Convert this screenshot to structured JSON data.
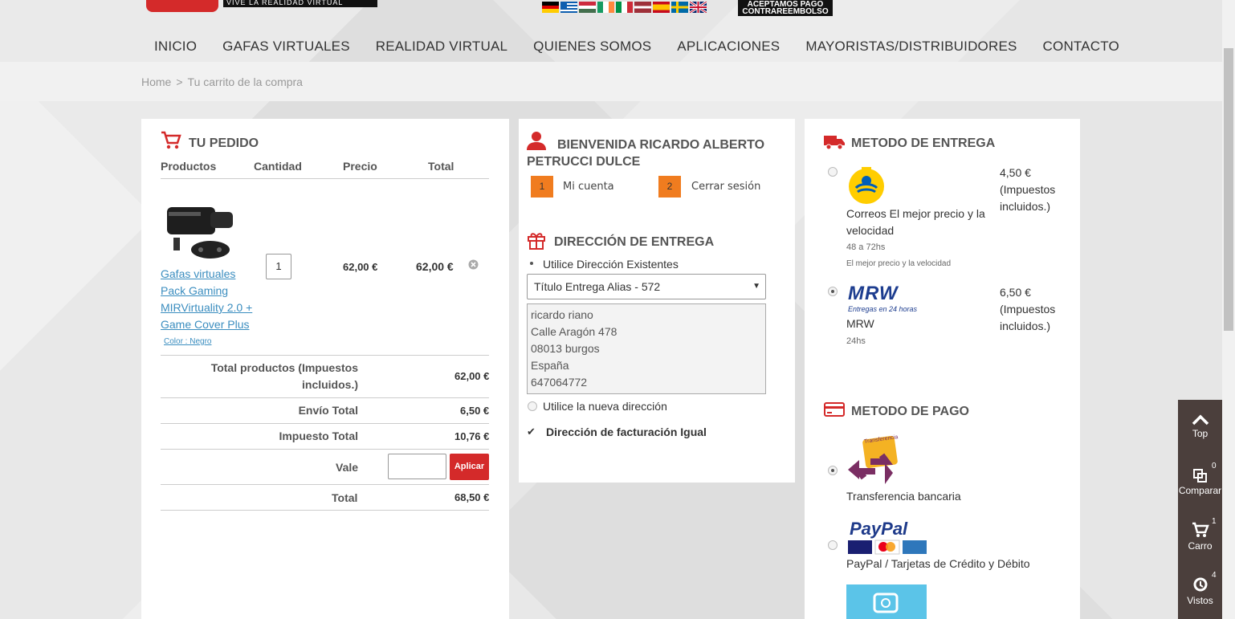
{
  "header": {
    "logo_tagline": "VIVE LA REALIDAD VIRTUAL",
    "cod_line1": "ACEPTAMOS PAGO",
    "cod_line2": "CONTRAREEMBOLSO",
    "flags": [
      "de",
      "gr",
      "hu",
      "ie",
      "it",
      "lv",
      "es",
      "se",
      "gb"
    ]
  },
  "nav": {
    "items": [
      "INICIO",
      "GAFAS VIRTUALES",
      "REALIDAD VIRTUAL",
      "QUIENES SOMOS",
      "APLICACIONES",
      "MAYORISTAS/DISTRIBUIDORES",
      "CONTACTO"
    ]
  },
  "breadcrumb": {
    "home": "Home",
    "sep": ">",
    "current": "Tu carrito de la compra"
  },
  "order": {
    "title": "TU PEDIDO",
    "col_products": "Productos",
    "col_qty": "Cantidad",
    "col_price": "Precio",
    "col_total": "Total",
    "product_name": "Gafas virtuales Pack Gaming MIRVirtuality 2.0 + Game Cover Plus",
    "product_color": "Color : Negro",
    "qty": "1",
    "price": "62,00 €",
    "total": "62,00 €",
    "subtotal_label": "Total productos (Impuestos incluidos.)",
    "subtotal_value": "62,00 €",
    "shipping_label": "Envío Total",
    "shipping_value": "6,50 €",
    "tax_label": "Impuesto Total",
    "tax_value": "10,76 €",
    "voucher_label": "Vale",
    "voucher_button": "Aplicar",
    "grand_label": "Total",
    "grand_value": "68,50 €"
  },
  "account": {
    "welcome": "BIENVENIDA RICARDO ALBERTO PETRUCCI DULCE",
    "step1_num": "1",
    "step1_label": "Mi cuenta",
    "step2_num": "2",
    "step2_label": "Cerrar sesión",
    "address_title": "DIRECCIÓN DE ENTREGA",
    "use_existing": "Utilice Dirección Existentes",
    "selected_address": "Título Entrega Alias - 572",
    "address_lines": [
      "ricardo riano",
      "Calle Aragón 478",
      "08013 burgos",
      "España",
      "647064772"
    ],
    "use_new": "Utilice la nueva dirección",
    "billing_same": "Dirección de facturación Igual"
  },
  "delivery": {
    "title": "METODO DE ENTREGA",
    "options": [
      {
        "name": "Correos El mejor precio y la velocidad",
        "time": "48 a 72hs",
        "desc": "El mejor precio y la velocidad",
        "price": "4,50 €",
        "tax": "(Impuestos incluidos.)",
        "logo": "correos-logo"
      },
      {
        "name": "MRW",
        "time": "24hs",
        "price": "6,50 €",
        "tax": "(Impuestos incluidos.)",
        "logo": "mrw-logo",
        "logo_text": "MRW",
        "logo_sub": "Entregas en 24 horas"
      }
    ]
  },
  "payment": {
    "title": "METODO DE PAGO",
    "options": [
      {
        "name": "Transferencia bancaria",
        "logo_text": "Transferencia"
      },
      {
        "name": "PayPal / Tarjetas de Crédito y Débito",
        "logo_text": "PayPal"
      }
    ]
  },
  "sidebar": {
    "top": "Top",
    "compare": "Comparar",
    "compare_count": "0",
    "cart": "Carro",
    "cart_count": "1",
    "viewed": "Vistos",
    "viewed_count": "4"
  },
  "colors": {
    "accent": "#d42a2a",
    "orange": "#f07c1f",
    "sidebar": "#4b3f3c"
  }
}
